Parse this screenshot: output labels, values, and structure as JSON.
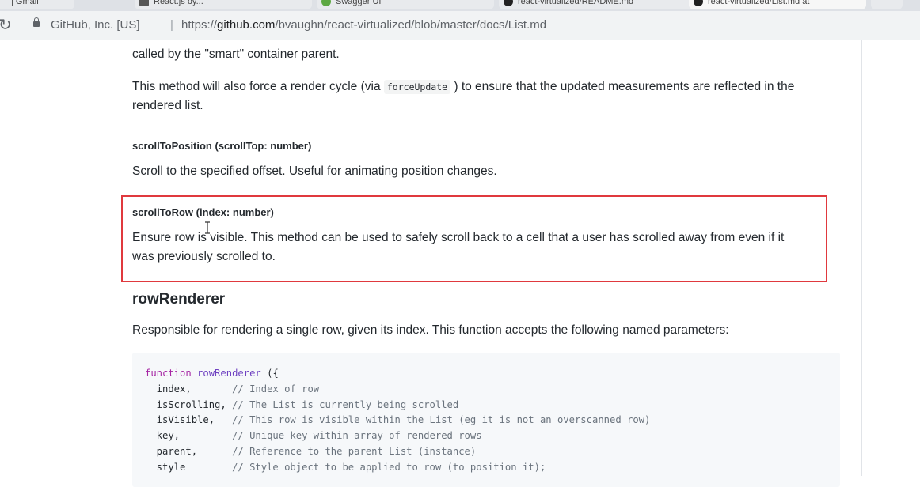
{
  "browser": {
    "tabs": [
      {
        "label": "| Gmail"
      },
      {
        "label": "React.js by..."
      },
      {
        "label": "Swagger UI"
      },
      {
        "label": "react-virtualized/README.md"
      },
      {
        "label": "react-virtualized/List.md at"
      }
    ],
    "site_identity": "GitHub, Inc. [US]",
    "url_separator": "|",
    "url": {
      "scheme": "https://",
      "host": "github.com",
      "path": "/bvaughn/react-virtualized/blob/master/docs/List.md"
    }
  },
  "doc": {
    "para_top": "called by the \"smart\" container parent.",
    "para_force_before": "This method will also force a render cycle (via ",
    "para_force_code": "forceUpdate",
    "para_force_after": ") to ensure that the updated measurements are reflected in the",
    "para_force_line2": "rendered list.",
    "scroll_to_position_heading": "scrollToPosition (scrollTop: number)",
    "scroll_to_position_desc": "Scroll to the specified offset. Useful for animating position changes.",
    "scroll_to_row_heading": "scrollToRow (index: number)",
    "scroll_to_row_desc_line1": "Ensure row is visible. This method can be used to safely scroll back to a cell that a user has scrolled away from even if it",
    "scroll_to_row_desc_line2": "was previously scrolled to.",
    "row_renderer_heading": "rowRenderer",
    "row_renderer_desc": "Responsible for rendering a single row, given its index. This function accepts the following named parameters:"
  },
  "code": {
    "keyword": "function",
    "fn_name": "rowRenderer",
    "open": " ({",
    "params": [
      {
        "name": "  index,       ",
        "comment": "// Index of row"
      },
      {
        "name": "  isScrolling, ",
        "comment": "// The List is currently being scrolled"
      },
      {
        "name": "  isVisible,   ",
        "comment": "// This row is visible within the List (eg it is not an overscanned row)"
      },
      {
        "name": "  key,         ",
        "comment": "// Unique key within array of rendered rows"
      },
      {
        "name": "  parent,      ",
        "comment": "// Reference to the parent List (instance)"
      },
      {
        "name": "  style        ",
        "comment": "// Style object to be applied to row (to position it);"
      }
    ]
  },
  "colors": {
    "highlight_border": "#e0393e",
    "code_bg": "#f6f8fa",
    "keyword": "#a626a4",
    "comment": "#6a737d"
  }
}
